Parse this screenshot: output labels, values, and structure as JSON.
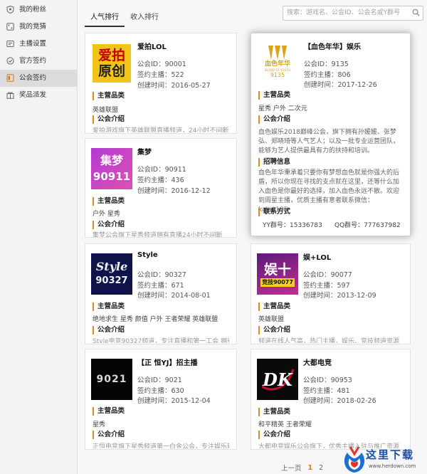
{
  "sidebar": {
    "items": [
      {
        "label": "我的粉丝",
        "icon": "shield-icon"
      },
      {
        "label": "我的竞猜",
        "icon": "dice-icon"
      },
      {
        "label": "主播设置",
        "icon": "settings-icon"
      },
      {
        "label": "官方签约",
        "icon": "seal-icon"
      },
      {
        "label": "公会签约",
        "icon": "contract-icon"
      },
      {
        "label": "奖品派发",
        "icon": "gift-icon"
      }
    ],
    "active_index": 4
  },
  "tabs": [
    "人气排行",
    "收入排行"
  ],
  "search": {
    "placeholder": "搜索：游戏名、公会ID、公会名或Y群号"
  },
  "labels": {
    "guild_id": "公会ID：",
    "signed": "签约主播：",
    "created": "创建时间：",
    "categories": "主营品类",
    "intro": "公会介绍",
    "recruit": "招聘信息",
    "contact": "联系方式"
  },
  "cards": [
    {
      "name": "爱拍LOL",
      "guild_id": "90001",
      "signed": "522",
      "created": "2016-05-27",
      "categories": "英雄联盟",
      "intro": "爱拍游戏旗下英雄联盟直播频道，24小时不间断"
    },
    {
      "name": "【血色年华】娱乐",
      "guild_id": "9135",
      "signed": "806",
      "created": "2017-12-26",
      "categories": "星秀 户外 二次元",
      "intro": "血色娱乐2018巅峰公会，旗下拥有孙媛媛、张梦弘、郑晓琦等人气艺人；以及一批专业运营团队，能够为艺人提供最具有力的扶持和培训。",
      "recruit": "血色年华秉承着只要你有梦想血色就是你强大的后盾，所以你现在寻找的支点就在这里，还等什么加入血色是你最好的选择，加入血色永远不散。欢迎到周星主播，优质主播有意者联系微信：kala9135",
      "yy_group_label": "YY群号：",
      "yy_group": "15336783",
      "qq_group_label": "QQ群号：",
      "qq_group": "777637982"
    },
    {
      "name": "集梦",
      "guild_id": "90911",
      "signed": "436",
      "created": "2016-12-12",
      "categories": "户外 星秀",
      "intro": "集梦公会旗下星秀频道拥有直播24小时不间断"
    },
    {
      "name": "Style",
      "guild_id": "90327",
      "signed": "671",
      "created": "2014-08-01",
      "categories": "绝地求生 星秀 颜值 户外 王者荣耀 英雄联盟",
      "intro": "Style电竞90327频道，专注直播和第一工会 拥有"
    },
    {
      "name": "娱+LOL",
      "guild_id": "90077",
      "signed": "597",
      "created": "2013-12-09",
      "categories": "英雄联盟",
      "intro": "频道在线人气高，热门主播，娱乐、竞技频道资源"
    },
    {
      "name": "【正 恒YJ】招主播",
      "guild_id": "9021",
      "signed": "630",
      "created": "2015-12-04",
      "categories": "星秀",
      "intro": "正恒电竞旗下星秀频道第一白金公会，专注娱乐新"
    },
    {
      "name": "大都电竞",
      "guild_id": "90953",
      "signed": "481",
      "created": "2018-02-26",
      "categories": "和平精英 王者荣耀",
      "intro": "大都电竞娱乐公会旗下，优秀主播入驻与推广资源"
    }
  ],
  "logos": {
    "c0": {
      "line1": "爱拍",
      "line2": "原创"
    },
    "c1": {
      "cn": "血色年华",
      "en": "BLOOD OF YOUTH",
      "num": "9135"
    },
    "c2": {
      "line1": "集梦",
      "num": "90911"
    },
    "c3": {
      "line1": "Style",
      "num": "90327"
    },
    "c4": {
      "line1": "娱十",
      "line2": "竞技90077"
    },
    "c5": {
      "num": "9021"
    },
    "c6": {
      "line1": "DK"
    }
  },
  "pager": {
    "prev": "上一页",
    "pages": [
      "1",
      "2"
    ],
    "current": "1"
  },
  "watermark": {
    "title": "这里下载",
    "url": "www.herdown.com"
  },
  "colors": {
    "accent": "#e08a17",
    "active_side": "#dcdcdc",
    "brand_blue": "#1b4fa5"
  }
}
